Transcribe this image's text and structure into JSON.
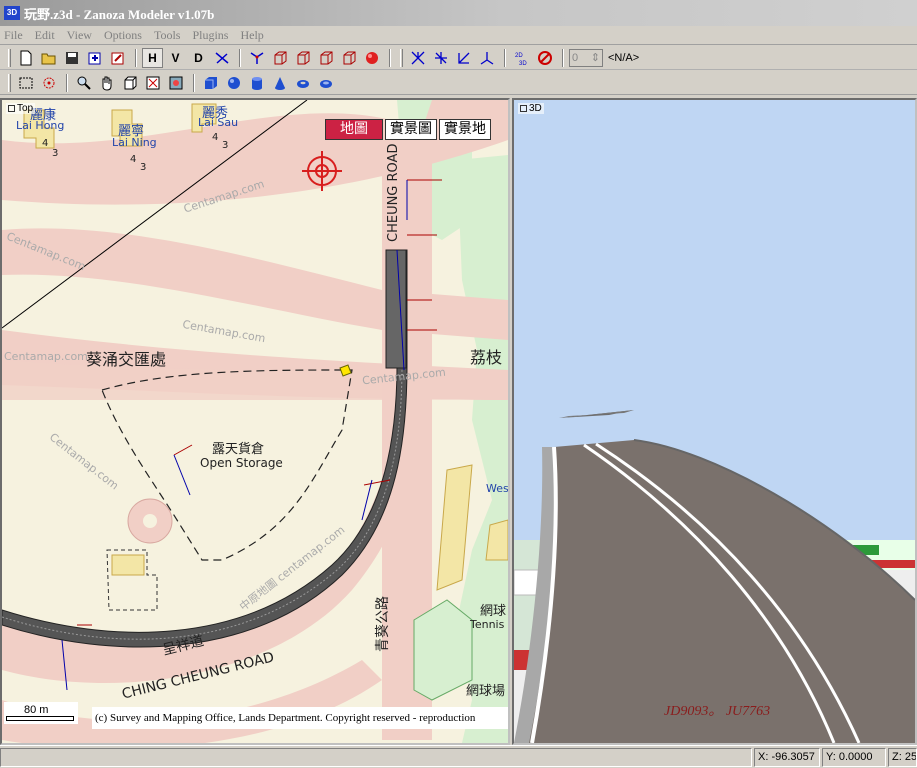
{
  "window": {
    "title": "玩野.z3d - Zanoza Modeler v1.07b",
    "icon_text": "3D"
  },
  "menu": [
    "File",
    "Edit",
    "View",
    "Options",
    "Tools",
    "Plugins",
    "Help"
  ],
  "toolbar": {
    "view_buttons": [
      "H",
      "V",
      "D"
    ],
    "spin_value": "0",
    "object_selector": "<N/A>"
  },
  "viewport_top": {
    "label": "Top",
    "tabs": [
      "地圖",
      "實景圖",
      "實景地"
    ],
    "labels": {
      "lai_hong_cn": "麗康",
      "lai_hong_en": "Lai Hong",
      "lai_ning_cn": "麗寧",
      "lai_ning_en": "Lai Ning",
      "lai_sau_cn": "麗秀",
      "lai_sau_en": "Lai Sau",
      "kwai_chung_interchange": "葵涌交匯處",
      "open_storage_cn": "露天貨倉",
      "open_storage_en": "Open Storage",
      "cheung_road_vertical": "CHEUNG ROAD",
      "ching_cheung_road": "CHING CHEUNG ROAD",
      "ching_cheung_cn": "呈祥道",
      "lai_chi_kok_cn": "荔枝",
      "tennis_cn": "網球",
      "tennis_en": "Tennis",
      "tennis_court_cn": "網球場",
      "west": "Wes",
      "ching_cheung_vertical_cn": "青葵公路",
      "centamap_1": "Centamap.com",
      "centamap_2": "Centamap.com",
      "centamap_3": "Centamap.com",
      "centamap_4": "Centamap.com",
      "centamap_5": "Centamap.com",
      "centamap_6": "Centamap.com",
      "centamap_7": "中原地圖 centamap.com",
      "num_4a": "4",
      "num_3a": "3",
      "num_4b": "4",
      "num_3b": "3",
      "num_4c": "4",
      "num_3c": "3"
    },
    "scale_label": "80 m",
    "copyright": "(c) Survey and Mapping Office, Lands Department. Copyright reserved - reproduction"
  },
  "viewport_3d": {
    "label": "3D",
    "watermark": "JD9093。 JU7763"
  },
  "status": {
    "x": "X: -96.3057",
    "y": "Y: 0.0000",
    "z": "Z: 25"
  },
  "colors": {
    "map_background": "#f6f2df",
    "road_pink": "#f1cfc6",
    "park_green": "#d7efd0",
    "sky": "#bfd6f3",
    "asphalt": "#7a716c",
    "tab_active": "#cc2244",
    "crosshair": "#d81e1e"
  }
}
